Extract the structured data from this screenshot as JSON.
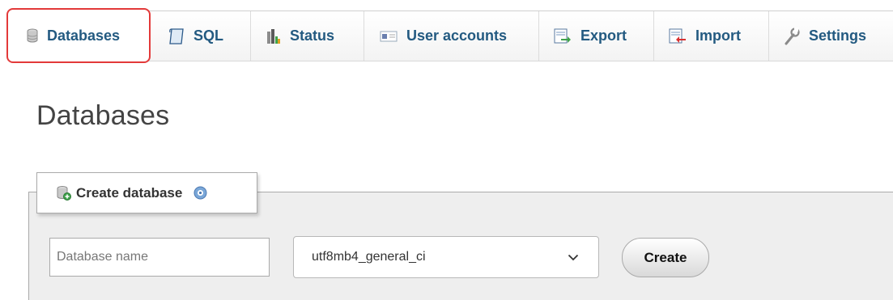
{
  "tabs": [
    {
      "label": "Databases",
      "icon": "database-icon",
      "active": true
    },
    {
      "label": "SQL",
      "icon": "sql-icon",
      "active": false
    },
    {
      "label": "Status",
      "icon": "status-chart-icon",
      "active": false
    },
    {
      "label": "User accounts",
      "icon": "user-accounts-icon",
      "active": false
    },
    {
      "label": "Export",
      "icon": "export-icon",
      "active": false
    },
    {
      "label": "Import",
      "icon": "import-icon",
      "active": false
    },
    {
      "label": "Settings",
      "icon": "wrench-icon",
      "active": false
    }
  ],
  "page": {
    "title": "Databases"
  },
  "create_database": {
    "legend": "Create database",
    "name_placeholder": "Database name",
    "name_value": "",
    "collation_value": "utf8mb4_general_ci",
    "create_label": "Create"
  },
  "colors": {
    "tab_text": "#235a81",
    "active_outline": "#e33a3a",
    "fieldset_bg": "#eeeeee"
  }
}
